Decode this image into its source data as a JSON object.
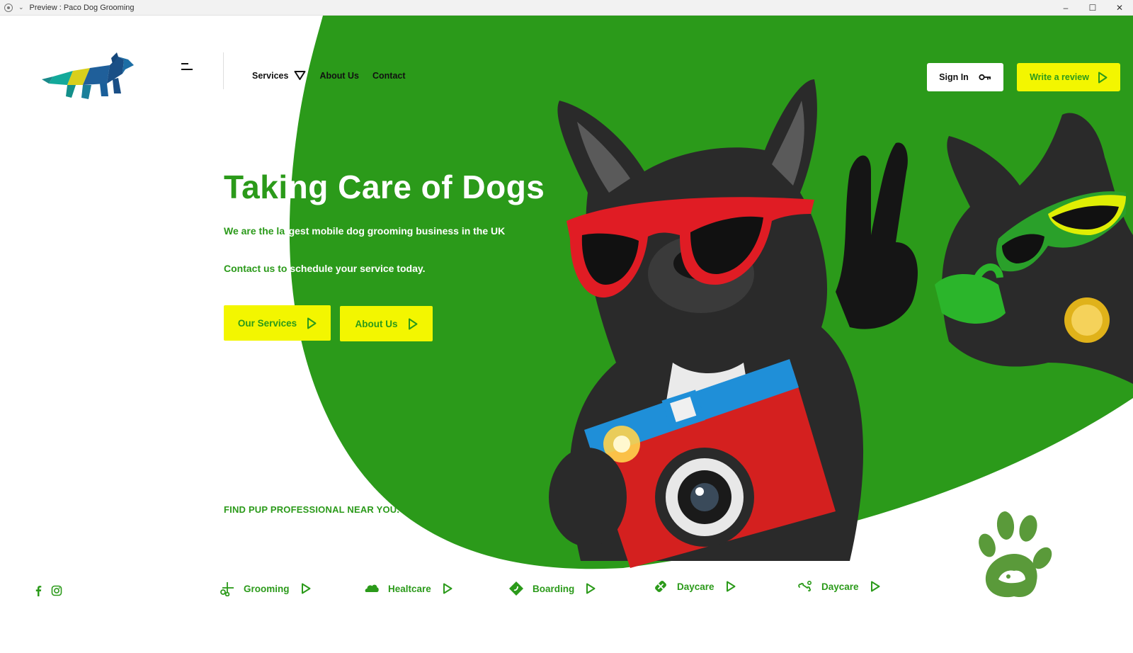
{
  "window": {
    "title": "Preview : Paco Dog Grooming",
    "controls": [
      "minimize-icon",
      "maximize-icon",
      "close-icon"
    ]
  },
  "brand": {
    "logo": "dachshund-logo-icon",
    "green": "#2b9a1a",
    "yellow": "#f3f600"
  },
  "nav": {
    "items": [
      {
        "label": "Services",
        "has_dropdown": true
      },
      {
        "label": "About Us"
      },
      {
        "label": "Contact"
      }
    ]
  },
  "header_actions": {
    "signin_label": "Sign In",
    "signin_icon": "key-icon",
    "review_label": "Write a review",
    "review_icon": "play-outline-icon"
  },
  "hero": {
    "title": "Taking Care of Dogs",
    "title_part1": "Taki",
    "title_part2": "ng Care of Dogs",
    "sub_line1_a": "We are the la",
    "sub_line1_b": "rgest mobile dog grooming business in the UK",
    "sub_line2_a": "Contact us to",
    "sub_line2_b": " schedule your service today.",
    "buttons": [
      {
        "label": "Our Services",
        "icon": "play-outline-icon"
      },
      {
        "label": "About Us",
        "icon": "play-outline-icon"
      }
    ],
    "find_text": "FIND PUP PROFESSIONAL NEAR YOU."
  },
  "services": [
    {
      "label": "Grooming",
      "icon": "scissors-icon"
    },
    {
      "label": "Healtcare",
      "icon": "cloud-icon"
    },
    {
      "label": "Boarding",
      "icon": "boarding-icon"
    },
    {
      "label": "Daycare",
      "icon": "bandage-icon"
    },
    {
      "label": "Daycare",
      "icon": "dog-bone-icon"
    }
  ],
  "social": [
    "facebook-icon",
    "instagram-icon"
  ]
}
